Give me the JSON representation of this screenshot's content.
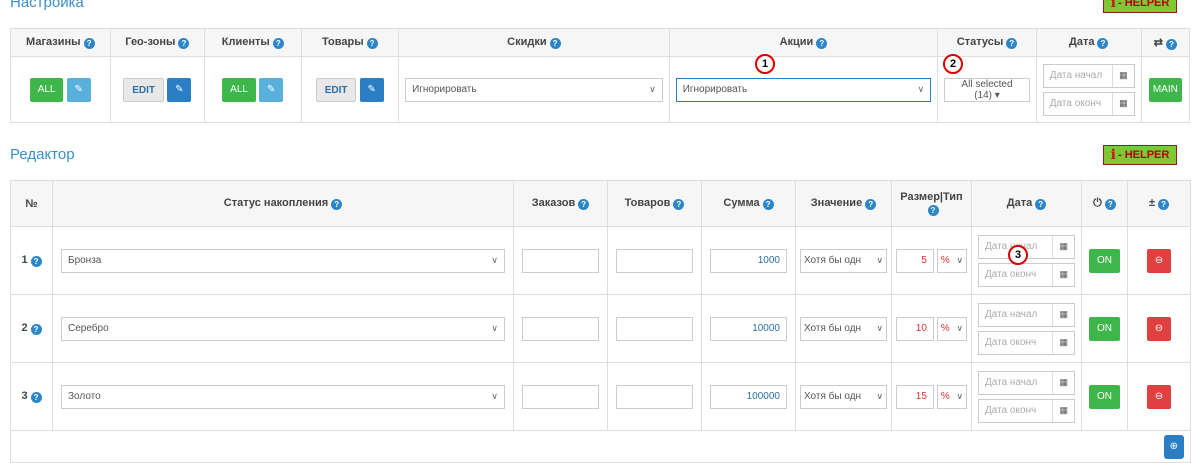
{
  "settings": {
    "title": "Настройка",
    "helper": {
      "icon": "i",
      "label": "- HELPER"
    },
    "cols": {
      "stores": "Магазины",
      "geo": "Гео-зоны",
      "clients": "Клиенты",
      "goods": "Товары",
      "discounts": "Скидки",
      "promos": "Акции",
      "statuses": "Статусы",
      "date": "Дата",
      "swap": "⇄"
    },
    "stores_btn": "ALL",
    "geo_btn": "EDIT",
    "clients_btn": "ALL",
    "goods_btn": "EDIT",
    "discounts_value": "Игнорировать",
    "promos_value": "Игнорировать",
    "statuses_value": "All selected (14) ▾",
    "date_start_ph": "Дата начал",
    "date_end_ph": "Дата оконч",
    "main_btn": "MAIN"
  },
  "editor": {
    "title": "Редактор",
    "helper": {
      "icon": "i",
      "label": "- HELPER"
    },
    "cols": {
      "no": "№",
      "status": "Статус накопления",
      "orders": "Заказов",
      "goods": "Товаров",
      "sum": "Сумма",
      "value": "Значение",
      "size_type": "Размер|Тип",
      "date": "Дата",
      "power": "⏻",
      "plusminus": "±"
    },
    "rows": [
      {
        "no": "1",
        "status": "Бронза",
        "sum": "1000",
        "value": "Хотя бы одн",
        "size": "5",
        "type": "%",
        "on": "ON"
      },
      {
        "no": "2",
        "status": "Серебро",
        "sum": "10000",
        "value": "Хотя бы одн",
        "size": "10",
        "type": "%",
        "on": "ON"
      },
      {
        "no": "3",
        "status": "Золото",
        "sum": "100000",
        "value": "Хотя бы одн",
        "size": "15",
        "type": "%",
        "on": "ON"
      }
    ],
    "date_start_ph": "Дата начал",
    "date_end_ph": "Дата оконч"
  },
  "markers": [
    "1",
    "2",
    "3"
  ]
}
